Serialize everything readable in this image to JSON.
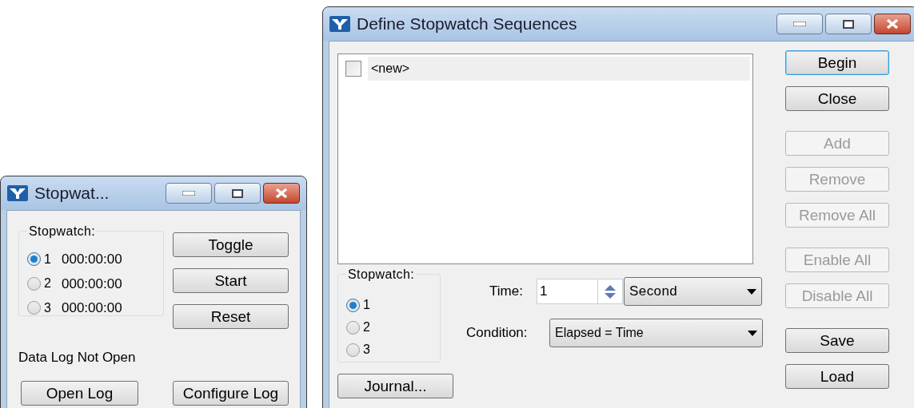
{
  "stopwatch_window": {
    "title": "Stopwat...",
    "stopwatch_group": {
      "label": "Stopwatch:",
      "options": [
        {
          "number": "1",
          "time": "000:00:00",
          "selected": true
        },
        {
          "number": "2",
          "time": "000:00:00",
          "selected": false
        },
        {
          "number": "3",
          "time": "000:00:00",
          "selected": false
        }
      ]
    },
    "buttons": [
      {
        "label": "Toggle"
      },
      {
        "label": "Start"
      },
      {
        "label": "Reset"
      }
    ],
    "log_status": "Data Log Not Open",
    "log_buttons": [
      {
        "label": "Open Log"
      },
      {
        "label": "Configure Log"
      }
    ]
  },
  "sequences_window": {
    "title": "Define Stopwatch Sequences",
    "list": [
      {
        "label": "<new>",
        "checked": false
      }
    ],
    "stopwatch_group": {
      "label": "Stopwatch:",
      "options": [
        {
          "number": "1",
          "selected": true
        },
        {
          "number": "2",
          "selected": false
        },
        {
          "number": "3",
          "selected": false
        }
      ]
    },
    "time": {
      "label": "Time:",
      "value": "1",
      "unit": "Second"
    },
    "condition": {
      "label": "Condition:",
      "value": "Elapsed = Time"
    },
    "journal_button": "Journal...",
    "button_groups": [
      [
        {
          "label": "Begin",
          "disabled": false,
          "default": true
        },
        {
          "label": "Close",
          "disabled": false,
          "default": false
        }
      ],
      [
        {
          "label": "Add",
          "disabled": true,
          "default": false
        },
        {
          "label": "Remove",
          "disabled": true,
          "default": false
        },
        {
          "label": "Remove All",
          "disabled": true,
          "default": false
        }
      ],
      [
        {
          "label": "Enable All",
          "disabled": true,
          "default": false
        },
        {
          "label": "Disable All",
          "disabled": true,
          "default": false
        }
      ],
      [
        {
          "label": "Save",
          "disabled": false,
          "default": false
        },
        {
          "label": "Load",
          "disabled": false,
          "default": false
        }
      ]
    ]
  }
}
